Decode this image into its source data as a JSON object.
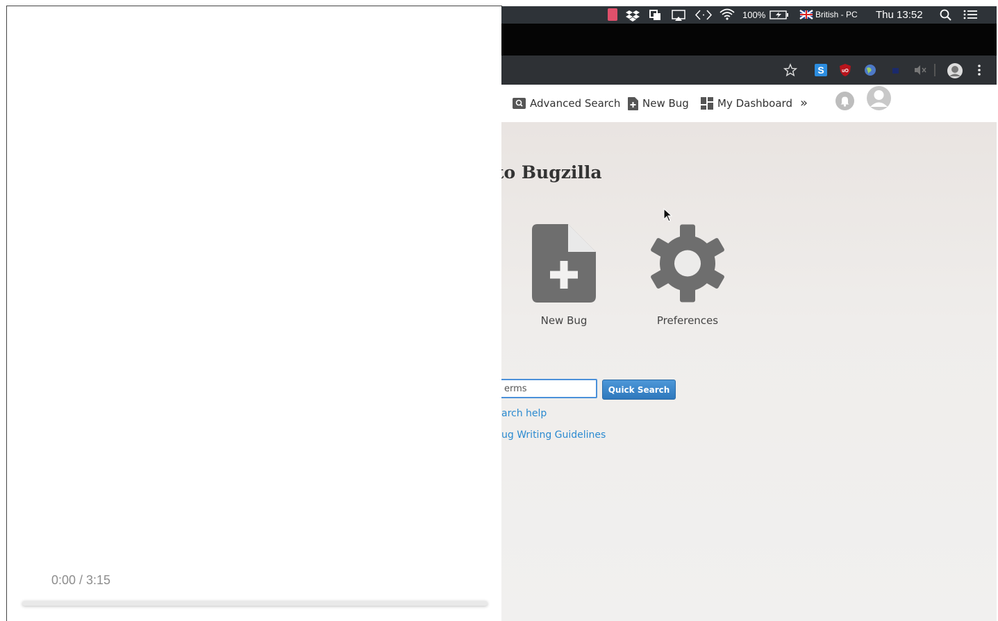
{
  "player": {
    "time_display": "0:00 / 3:15",
    "progress": 0
  },
  "menubar": {
    "battery": "100%",
    "keyboard": "British - PC",
    "clock": "Thu 13:52"
  },
  "bugzilla_header": {
    "links": [
      {
        "label": "Advanced Search",
        "icon": "search-box-icon"
      },
      {
        "label": "New Bug",
        "icon": "file-plus-icon"
      },
      {
        "label": "My Dashboard",
        "icon": "dashboard-grid-icon"
      }
    ],
    "more_label": "»"
  },
  "main": {
    "welcome_text": "to Bugzilla",
    "actions": [
      {
        "label": "New Bug",
        "icon": "new-bug-file-icon"
      },
      {
        "label": "Preferences",
        "icon": "gear-icon"
      }
    ],
    "search": {
      "value": "erms",
      "button_label": "Quick Search"
    },
    "links": [
      {
        "label": "arch help"
      },
      {
        "label": "ug Writing Guidelines"
      }
    ]
  },
  "colors": {
    "link_blue": "#2b8ad0",
    "button_blue": "#3584ca",
    "icon_gray": "#6e6e6e",
    "menubar_dark": "#2e3338"
  }
}
